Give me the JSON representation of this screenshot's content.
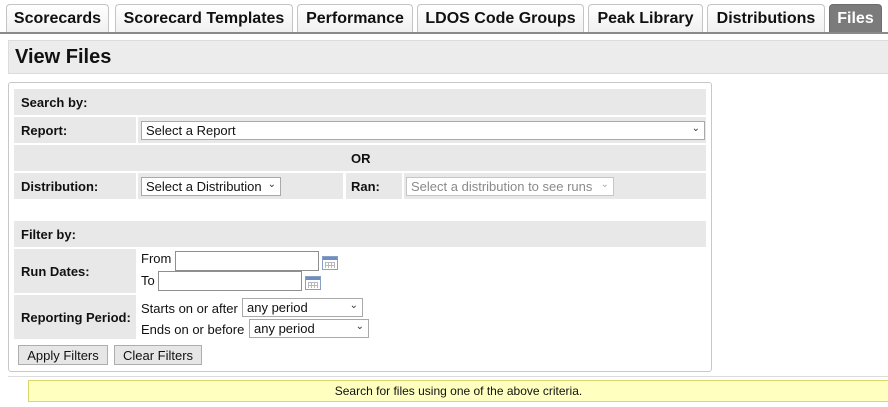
{
  "tabs": [
    {
      "label": "Scorecards"
    },
    {
      "label": "Scorecard Templates"
    },
    {
      "label": "Performance"
    },
    {
      "label": "LDOS Code Groups"
    },
    {
      "label": "Peak Library"
    },
    {
      "label": "Distributions"
    },
    {
      "label": "Files",
      "active": true
    }
  ],
  "page": {
    "title": "View Files"
  },
  "search": {
    "header": "Search by:",
    "report_label": "Report:",
    "report_value": "Select a Report",
    "or_text": "OR",
    "distribution_label": "Distribution:",
    "distribution_value": "Select a Distribution",
    "ran_label": "Ran:",
    "ran_value": "Select a distribution to see runs"
  },
  "filter": {
    "header": "Filter by:",
    "run_dates_label": "Run Dates:",
    "from_label": "From",
    "to_label": "To",
    "reporting_period_label": "Reporting Period:",
    "starts_label": "Starts on or after",
    "starts_value": "any period",
    "ends_label": "Ends on or before",
    "ends_value": "any period",
    "apply_button": "Apply Filters",
    "clear_button": "Clear Filters"
  },
  "status": {
    "message": "Search for files using one of the above criteria."
  },
  "icons": {
    "dropdown": "chevron-down-icon",
    "calendar": "calendar-icon"
  }
}
